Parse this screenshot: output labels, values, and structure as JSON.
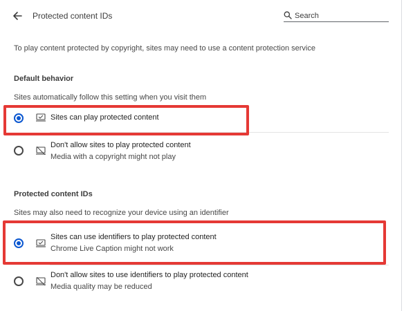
{
  "header": {
    "title": "Protected content IDs",
    "search_placeholder": "Search"
  },
  "description": "To play content protected by copyright, sites may need to use a content protection service",
  "default_behavior": {
    "title": "Default behavior",
    "subtitle": "Sites automatically follow this setting when you visit them",
    "options": [
      {
        "label": "Sites can play protected content",
        "sub": "",
        "selected": true,
        "icon": "laptop-check-icon"
      },
      {
        "label": "Don't allow sites to play protected content",
        "sub": "Media with a copyright might not play",
        "selected": false,
        "icon": "laptop-blocked-icon"
      }
    ]
  },
  "ids_section": {
    "title": "Protected content IDs",
    "subtitle": "Sites may also need to recognize your device using an identifier",
    "options": [
      {
        "label": "Sites can use identifiers to play protected content",
        "sub": "Chrome Live Caption might not work",
        "selected": true,
        "icon": "laptop-check-icon"
      },
      {
        "label": "Don't allow sites to use identifiers to play protected content",
        "sub": "Media quality may be reduced",
        "selected": false,
        "icon": "laptop-blocked-icon"
      }
    ]
  },
  "colors": {
    "accent": "#0b57d0",
    "highlight": "#e53935"
  }
}
